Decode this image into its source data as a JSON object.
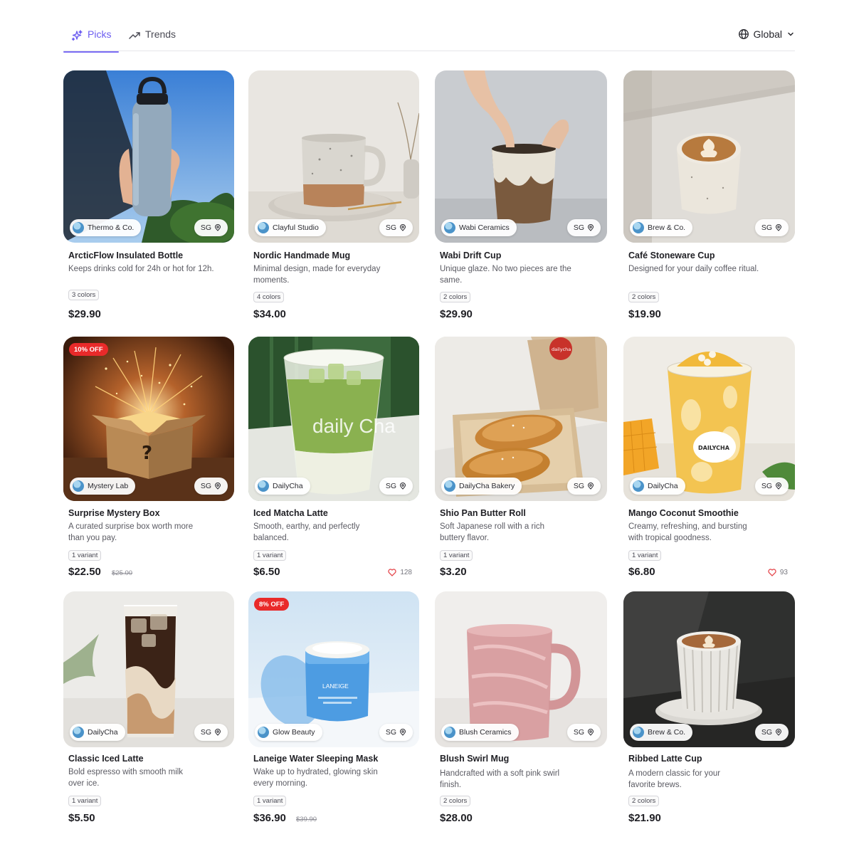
{
  "tabs": [
    {
      "label": "Picks",
      "icon": "sparkles-icon",
      "active": true
    },
    {
      "label": "Trends",
      "icon": "trending-up-icon",
      "active": false
    }
  ],
  "region_selector": {
    "label": "Global",
    "icon": "globe-icon"
  },
  "colors": {
    "accent": "#6b5cf0",
    "discount": "#e92a2a",
    "heart": "#e5484d"
  },
  "products": [
    {
      "seller": "Thermo & Co.",
      "region": "SG",
      "title": "ArcticFlow Insulated Bottle",
      "desc": "Keeps drinks cold for 24h or hot for 12h.",
      "variant": "3 colors",
      "price": "$29.90"
    },
    {
      "seller": "Clayful Studio",
      "region": "SG",
      "title": "Nordic Handmade Mug",
      "desc": "Minimal design, made for everyday moments.",
      "variant": "4 colors",
      "price": "$34.00"
    },
    {
      "seller": "Wabi Ceramics",
      "region": "SG",
      "title": "Wabi Drift Cup",
      "desc": "Unique glaze. No two pieces are the same.",
      "variant": "2 colors",
      "price": "$29.90"
    },
    {
      "seller": "Brew & Co.",
      "region": "SG",
      "title": "Café Stoneware Cup",
      "desc": "Designed for your daily coffee ritual.",
      "variant": "2 colors",
      "price": "$19.90"
    },
    {
      "seller": "Mystery Lab",
      "region": "SG",
      "title": "Surprise Mystery Box",
      "desc": "A curated surprise box worth more than you pay.",
      "variant": "1 variant",
      "price": "$22.50",
      "old_price": "$25.00",
      "discount": "10% OFF"
    },
    {
      "seller": "DailyCha",
      "region": "SG",
      "title": "Iced Matcha Latte",
      "desc": "Smooth, earthy, and perfectly balanced.",
      "variant": "1 variant",
      "price": "$6.50",
      "likes": "128",
      "photo_text": "daily Cha"
    },
    {
      "seller": "DailyCha Bakery",
      "region": "SG",
      "title": "Shio Pan Butter Roll",
      "desc": "Soft Japanese roll with a rich buttery flavor.",
      "variant": "1 variant",
      "price": "$3.20",
      "photo_text": "dailycha"
    },
    {
      "seller": "DailyCha",
      "region": "SG",
      "title": "Mango Coconut Smoothie",
      "desc": "Creamy, refreshing, and bursting with tropical goodness.",
      "variant": "1 variant",
      "price": "$6.80",
      "likes": "93",
      "photo_text": "DAILYCHA"
    },
    {
      "seller": "DailyCha",
      "region": "SG",
      "title": "Classic Iced Latte",
      "desc": "Bold espresso with smooth milk over ice.",
      "variant": "1 variant",
      "price": "$5.50"
    },
    {
      "seller": "Glow Beauty",
      "region": "SG",
      "title": "Laneige Water Sleeping Mask",
      "desc": "Wake up to hydrated, glowing skin every morning.",
      "variant": "1 variant",
      "price": "$36.90",
      "old_price": "$39.90",
      "discount": "8% OFF",
      "photo_text": "LANEIGE"
    },
    {
      "seller": "Blush Ceramics",
      "region": "SG",
      "title": "Blush Swirl Mug",
      "desc": "Handcrafted with a soft pink swirl finish.",
      "variant": "2 colors",
      "price": "$28.00"
    },
    {
      "seller": "Brew & Co.",
      "region": "SG",
      "title": "Ribbed Latte Cup",
      "desc": "A modern classic for your favorite brews.",
      "variant": "2 colors",
      "price": "$21.90"
    }
  ]
}
